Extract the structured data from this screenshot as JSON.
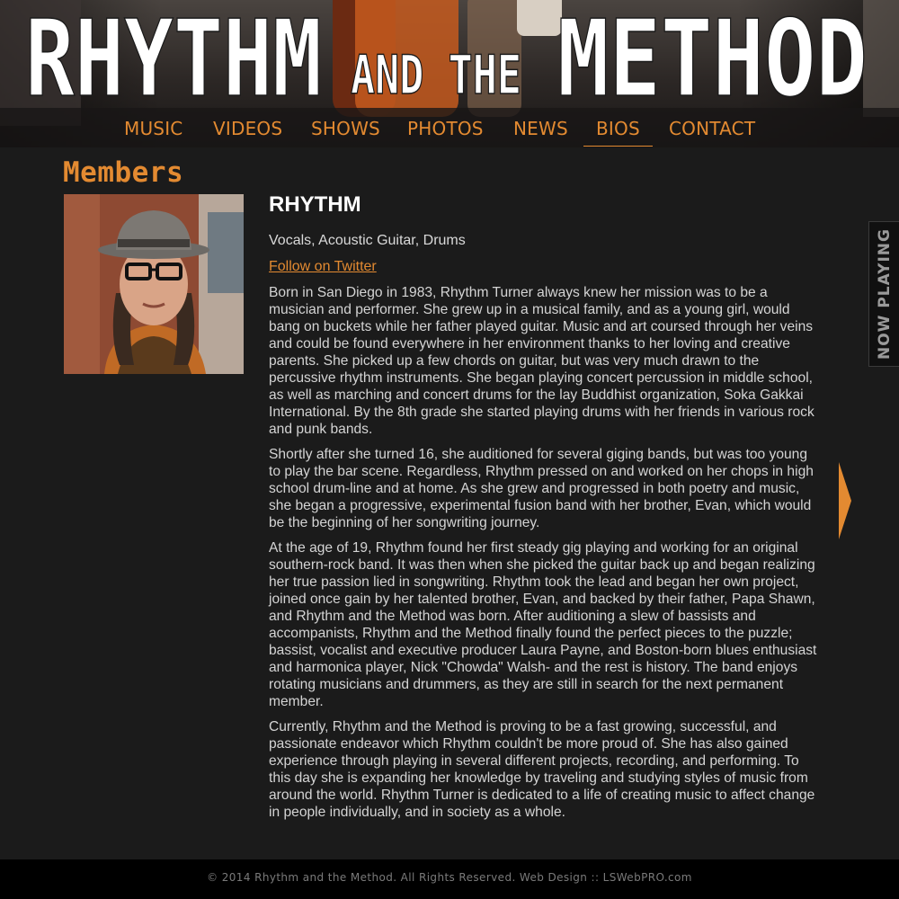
{
  "header": {
    "logo_word1": "RHYTHM",
    "logo_word2": "AND THE",
    "logo_word3": "METHOD"
  },
  "nav": {
    "items": [
      {
        "label": "MUSIC",
        "active": false
      },
      {
        "label": "VIDEOS",
        "active": false
      },
      {
        "label": "SHOWS",
        "active": false
      },
      {
        "label": "PHOTOS",
        "active": false
      },
      {
        "label": "NEWS",
        "active": false
      },
      {
        "label": "BIOS",
        "active": true
      },
      {
        "label": "CONTACT",
        "active": false
      }
    ]
  },
  "main": {
    "section_title": "Members",
    "member": {
      "name": "RHYTHM",
      "role": "Vocals, Acoustic Guitar, Drums",
      "twitter_label": "Follow on Twitter",
      "bio": [
        "Born in San Diego in 1983, Rhythm Turner always knew her mission was to be a musician and performer. She grew up in a musical family, and as a young girl, would bang on buckets while her father played guitar. Music and art coursed through her veins and could be found everywhere in her environment thanks to her loving and creative parents. She picked up a few chords on guitar, but was very much drawn to the percussive rhythm instruments. She began playing concert percussion in middle school, as well as marching and concert drums for the lay Buddhist organization, Soka Gakkai International. By the 8th grade she started playing drums with her friends in various rock and punk bands.",
        "Shortly after she turned 16, she auditioned for several giging bands, but was too young to play the bar scene. Regardless, Rhythm pressed on and worked on her chops in high school drum-line and at home. As she grew and progressed in both poetry and music, she began a progressive, experimental fusion band with her brother, Evan, which would be the beginning of her songwriting journey.",
        "At the age of 19, Rhythm found her first steady gig playing and working for an original southern-rock band. It was then when she picked the guitar back up and began realizing her true passion lied in songwriting. Rhythm took the lead and began her own project, joined once gain by her talented brother, Evan, and backed by their father, Papa Shawn, and Rhythm and the Method was born. After auditioning a slew of bassists and accompanists, Rhythm and the Method finally found the perfect pieces to the puzzle; bassist, vocalist and executive producer Laura Payne, and Boston-born blues enthusiast and harmonica player, Nick \"Chowda\" Walsh- and the rest is history. The band enjoys rotating musicians and drummers, as they are still in search for the next permanent member.",
        "Currently, Rhythm and the Method is proving to be a fast growing, successful, and passionate endeavor which Rhythm couldn't be more proud of. She has also gained experience through playing in several different projects, recording, and performing. To this day she is expanding her knowledge by traveling and studying styles of music from around the world. Rhythm Turner is dedicated to a life of creating music to affect change in people individually, and in society as a whole."
      ]
    }
  },
  "sidebar": {
    "now_playing_label": "NOW PLAYING"
  },
  "footer": {
    "text": "© 2014 Rhythm and the Method. All Rights Reserved. Web Design :: LSWebPRO.com"
  },
  "colors": {
    "accent": "#e38a31",
    "background": "#1b1b1b",
    "footer_bg": "#000000",
    "text": "#d9d9d9"
  }
}
